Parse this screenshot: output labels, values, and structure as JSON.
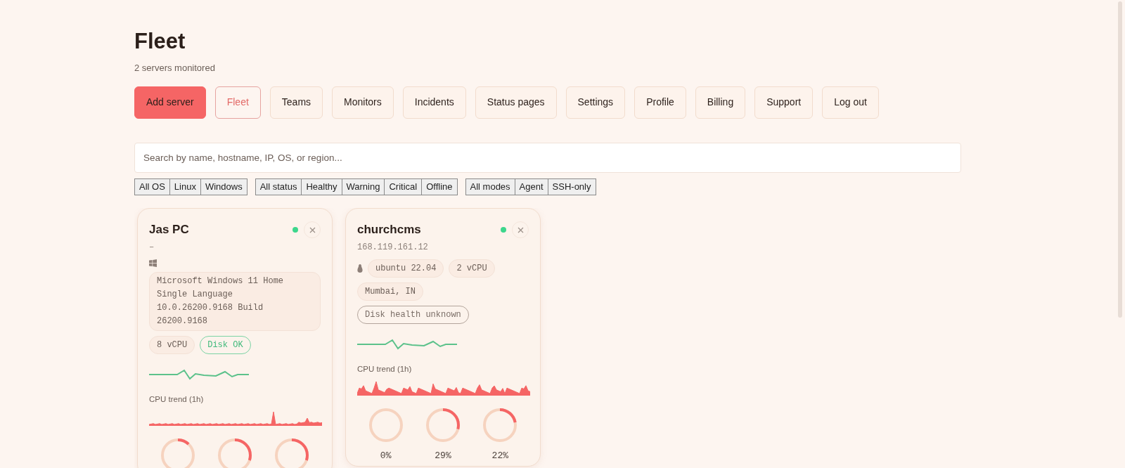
{
  "title": "Fleet",
  "subtitle": "2 servers monitored",
  "nav": [
    {
      "label": "Add server",
      "kind": "primary",
      "selected": false
    },
    {
      "label": "Fleet",
      "kind": "link",
      "selected": true
    },
    {
      "label": "Teams",
      "kind": "link",
      "selected": false
    },
    {
      "label": "Monitors",
      "kind": "link",
      "selected": false
    },
    {
      "label": "Incidents",
      "kind": "link",
      "selected": false
    },
    {
      "label": "Status pages",
      "kind": "link",
      "selected": false
    },
    {
      "label": "Settings",
      "kind": "link",
      "selected": false
    },
    {
      "label": "Profile",
      "kind": "link",
      "selected": false
    },
    {
      "label": "Billing",
      "kind": "link",
      "selected": false
    },
    {
      "label": "Support",
      "kind": "link",
      "selected": false
    },
    {
      "label": "Log out",
      "kind": "link",
      "selected": false
    }
  ],
  "search": {
    "placeholder": "Search by name, hostname, IP, OS, or region..."
  },
  "filter_groups": [
    {
      "options": [
        {
          "label": "All OS"
        },
        {
          "label": "Linux"
        },
        {
          "label": "Windows"
        }
      ]
    },
    {
      "options": [
        {
          "label": "All status"
        },
        {
          "label": "Healthy"
        },
        {
          "label": "Warning"
        },
        {
          "label": "Critical"
        },
        {
          "label": "Offline"
        }
      ]
    },
    {
      "options": [
        {
          "label": "All modes"
        },
        {
          "label": "Agent"
        },
        {
          "label": "SSH-only"
        }
      ]
    }
  ],
  "servers": [
    {
      "name": "Jas PC",
      "subtitle": "–",
      "color": "#3dd68c",
      "kind": "windows",
      "os_detail": "Microsoft Windows 11 Home Single Language 10.0.26200.9168 Build 26200.9168",
      "tags": [
        {
          "label": "8 vCPU",
          "kind": "plain"
        },
        {
          "label": "Disk OK",
          "kind": "ok"
        }
      ],
      "trend_label": "CPU trend (1h)",
      "gauges": [
        {
          "level": 0.12
        },
        {
          "level": 0.3
        },
        {
          "level": 0.3
        }
      ]
    },
    {
      "name": "churchcms",
      "subtitle": "168.119.161.12",
      "color": "#3dd68c",
      "kind": "linux",
      "tags": [
        {
          "label": "ubuntu 22.04",
          "kind": "plain"
        },
        {
          "label": "2 vCPU",
          "kind": "plain"
        },
        {
          "label": "Mumbai, IN",
          "kind": "plain"
        },
        {
          "label": "Disk health unknown",
          "kind": "outline"
        }
      ],
      "trend_label": "CPU trend (1h)",
      "gauges": [
        {
          "level": 0,
          "reading": "0%"
        },
        {
          "level": 0.29,
          "reading": "29%"
        },
        {
          "level": 0.22,
          "reading": "22%"
        }
      ]
    }
  ]
}
